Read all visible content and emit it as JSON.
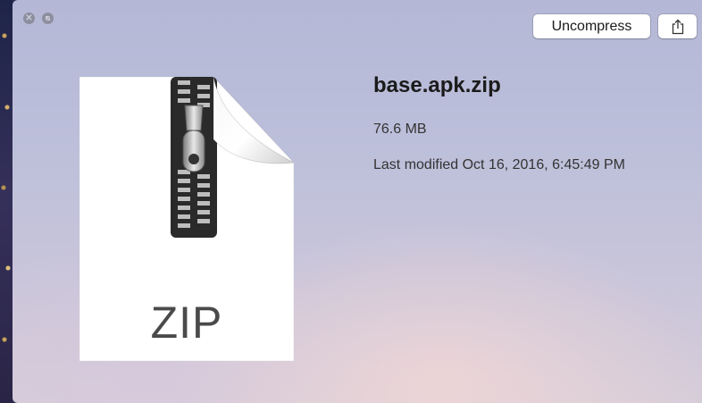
{
  "window": {
    "close_icon": "close-icon",
    "minimize_icon": "minimize-icon"
  },
  "toolbar": {
    "uncompress_label": "Uncompress",
    "share_icon": "share-icon"
  },
  "file": {
    "type_label": "ZIP",
    "name": "base.apk.zip",
    "size": "76.6 MB",
    "modified": "Last modified Oct 16, 2016, 6:45:49 PM",
    "icon": "zip-file-icon"
  },
  "colors": {
    "background_top": "#b4b8d6",
    "background_bottom": "#d7cdd9",
    "button_bg": "#ffffff",
    "text_primary": "#1b1b1b"
  }
}
